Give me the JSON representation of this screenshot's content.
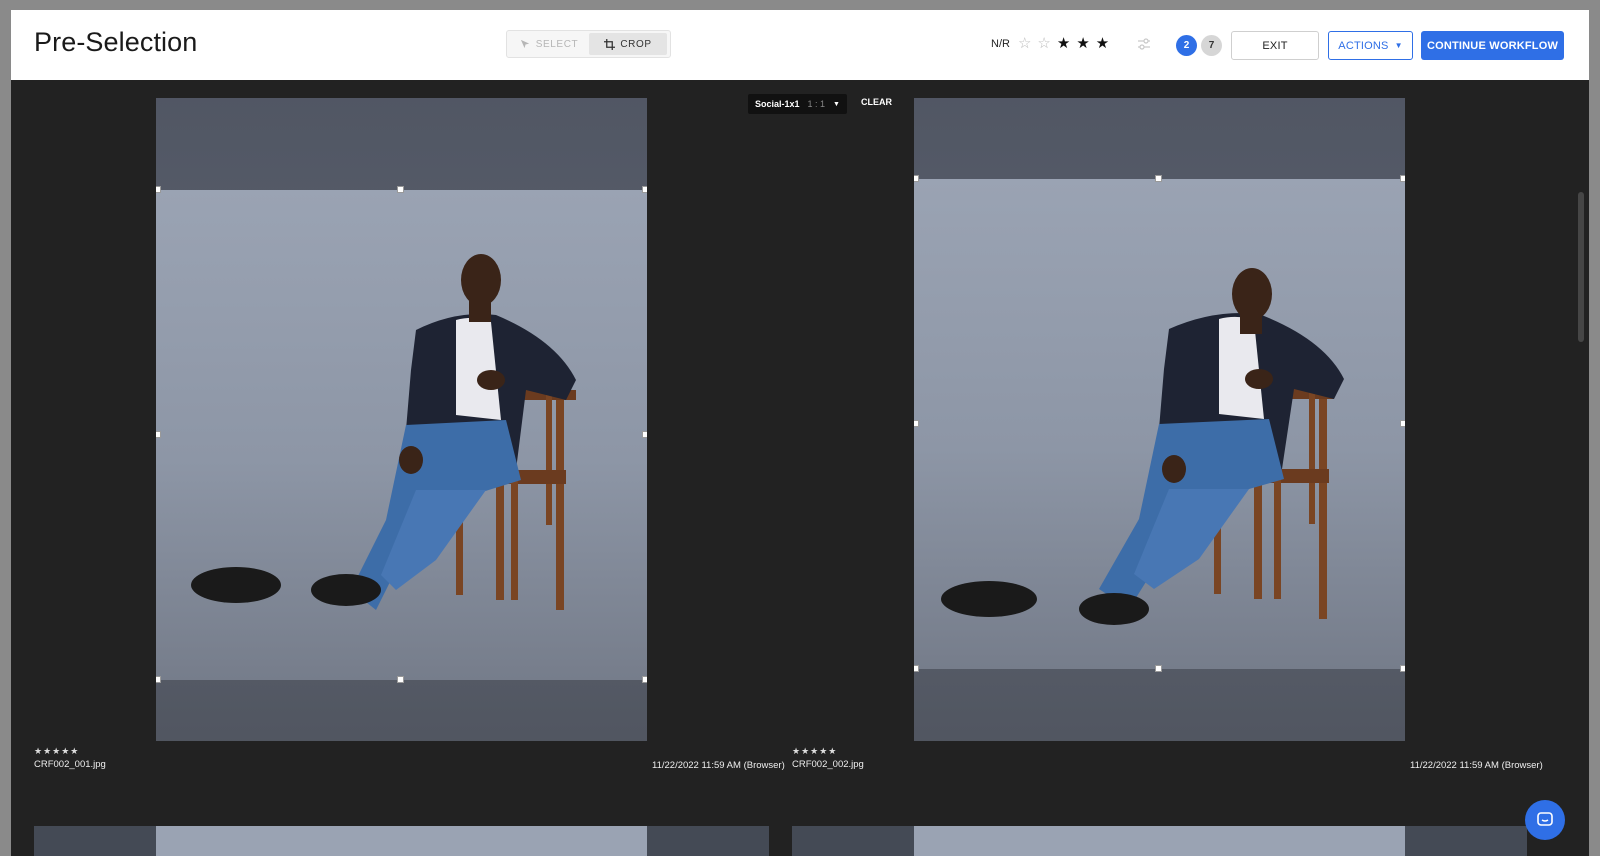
{
  "header": {
    "title": "Pre-Selection",
    "modes": {
      "select": "SELECT",
      "crop": "CROP",
      "active": "crop"
    },
    "rating": {
      "label": "N/R",
      "stars_empty": 2,
      "stars_full": 3
    },
    "badges": {
      "selected": "2",
      "total": "7"
    },
    "buttons": {
      "exit": "EXIT",
      "actions": "ACTIONS",
      "continue": "CONTINUE WORKFLOW"
    }
  },
  "crop_toolbar": {
    "preset": "Social-1x1",
    "ratio": "1 : 1",
    "clear": "CLEAR"
  },
  "images": [
    {
      "stars": "★★★★★",
      "filename": "CRF002_001.jpg",
      "date": "11/22/2022 11:59 AM",
      "source": "(Browser)"
    },
    {
      "stars": "★★★★★",
      "filename": "CRF002_002.jpg",
      "date": "11/22/2022 11:59 AM",
      "source": "(Browser)"
    }
  ],
  "colors": {
    "accent": "#2f6fe6",
    "background": "#222222"
  }
}
